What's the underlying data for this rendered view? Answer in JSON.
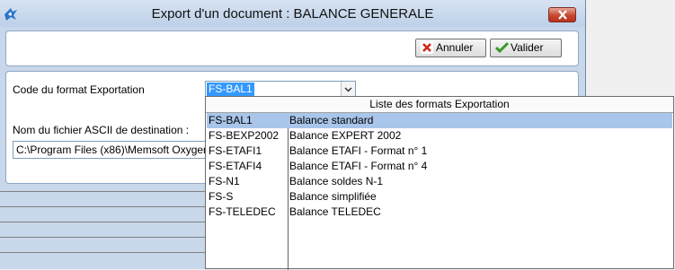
{
  "window": {
    "title": "Export d'un document : BALANCE GENERALE"
  },
  "toolbar": {
    "annuler_label": "Annuler",
    "valider_label": "Valider"
  },
  "form": {
    "code_label": "Code du format Exportation",
    "code_value": "FS-BAL1",
    "file_label": "Nom du fichier ASCII de destination :",
    "file_value": "C:\\Program Files (x86)\\Memsoft Oxyger"
  },
  "dropdown": {
    "header": "Liste des formats Exportation",
    "selected_index": 0,
    "items": [
      {
        "code": "FS-BAL1",
        "name": "Balance standard"
      },
      {
        "code": "FS-BEXP2002",
        "name": "Balance EXPERT 2002"
      },
      {
        "code": "FS-ETAFI1",
        "name": "Balance ETAFI - Format n° 1"
      },
      {
        "code": "FS-ETAFI4",
        "name": "Balance ETAFI - Format n° 4"
      },
      {
        "code": "FS-N1",
        "name": "Balance soldes N-1"
      },
      {
        "code": "FS-S",
        "name": "Balance simplifiée"
      },
      {
        "code": "FS-TELEDEC",
        "name": "Balance TELEDEC"
      }
    ]
  },
  "icons": {
    "app": "app-icon",
    "close": "close-icon",
    "annuler": "cancel-x-icon",
    "valider": "check-icon",
    "combo": "chevron-down-icon"
  }
}
